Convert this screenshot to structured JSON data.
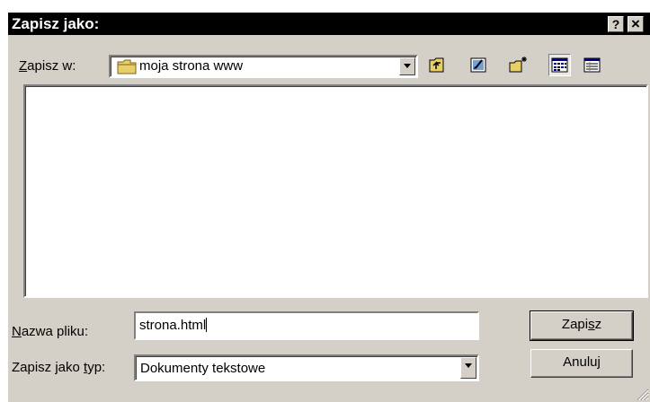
{
  "window": {
    "title": "Zapisz jako:",
    "help_glyph": "?",
    "close_glyph": "×"
  },
  "save_in": {
    "label_first": "Z",
    "label_rest": "apisz w:",
    "folder_name": "moja strona www",
    "folder_icon": "folder-icon"
  },
  "toolbar": {
    "icons": [
      "up-one-level-icon",
      "desktop-icon",
      "new-folder-icon",
      "list-view-icon",
      "details-view-icon"
    ],
    "active_view": "list-view"
  },
  "file_list": {
    "items": []
  },
  "filename": {
    "label_first": "N",
    "label_rest": "azwa pliku:",
    "value": "strona.html"
  },
  "filetype": {
    "label_before": "Zapisz jako ",
    "label_underlined": "t",
    "label_after": "yp:",
    "value": "Dokumenty tekstowe"
  },
  "buttons": {
    "save_before": "Zapi",
    "save_underlined": "s",
    "save_after": "z",
    "cancel": "Anuluj"
  },
  "colors": {
    "titlebar": "#000000",
    "face": "#d4d0c8",
    "folder": "#e8d068"
  }
}
